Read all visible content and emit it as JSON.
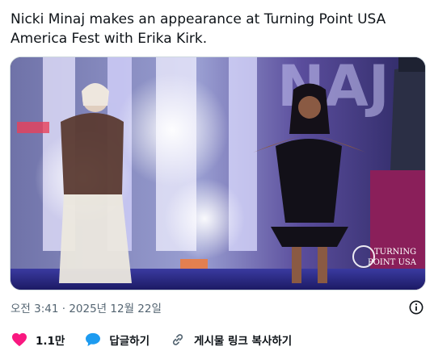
{
  "tweet": {
    "text_line1": "Nicki Minaj makes an appearance at Turning Point USA",
    "text_line2": "America Fest with Erika Kirk."
  },
  "media": {
    "logo_line1": "TURNING",
    "logo_line2": "POINT USA",
    "backdrop_letters": "NAJ"
  },
  "meta": {
    "timestamp": "오전 3:41 · 2025년 12월 22일",
    "info_icon": "info-circle-icon"
  },
  "actions": {
    "like_count": "1.1만",
    "reply_label": "답글하기",
    "copy_link_label": "게시물 링크 복사하기"
  },
  "colors": {
    "like": "#f91880",
    "reply": "#1d9bf0",
    "muted": "#536471"
  }
}
